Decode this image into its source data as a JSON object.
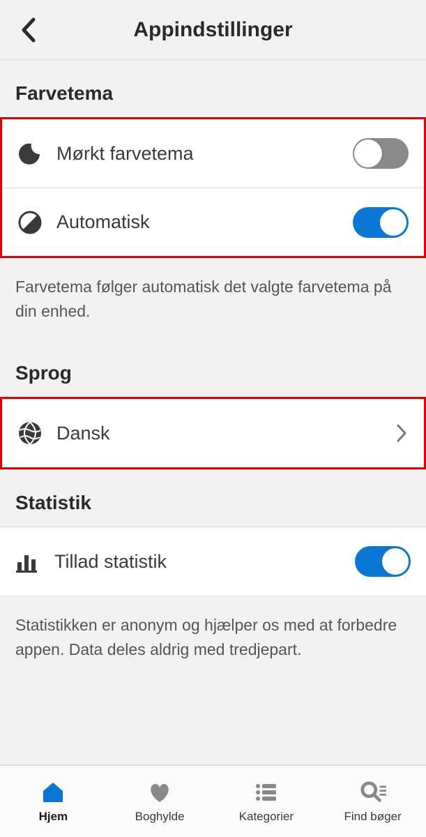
{
  "header": {
    "title": "Appindstillinger"
  },
  "theme": {
    "section_title": "Farvetema",
    "dark_label": "Mørkt farvetema",
    "dark_on": false,
    "auto_label": "Automatisk",
    "auto_on": true,
    "helper": "Farvetema følger automatisk det valgte farvetema på din enhed."
  },
  "language": {
    "section_title": "Sprog",
    "current": "Dansk"
  },
  "statistics": {
    "section_title": "Statistik",
    "allow_label": "Tillad statistik",
    "allow_on": true,
    "helper": "Statistikken er anonym og hjælper os med at forbedre appen. Data deles aldrig med tredjepart."
  },
  "tabs": {
    "home": "Hjem",
    "bookshelf": "Boghylde",
    "categories": "Kategorier",
    "find_books": "Find bøger"
  },
  "colors": {
    "accent": "#0a77d5",
    "highlight": "#e30000"
  }
}
